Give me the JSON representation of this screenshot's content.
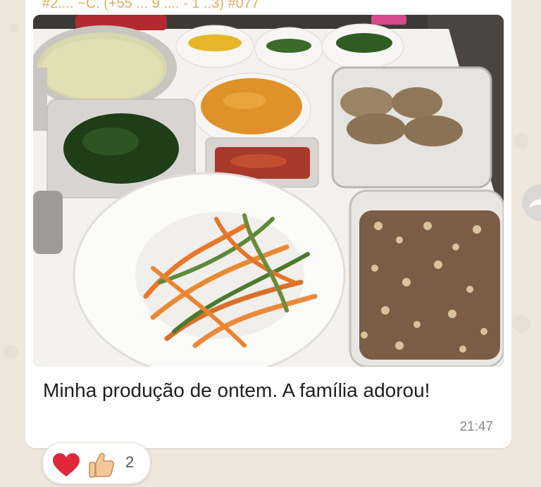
{
  "message": {
    "sender_line": "#2.... ~C. (+55 ... 9 .... - 1 ..3) #077",
    "image_alt": "Mesa com vários pratos de comida preparada",
    "caption": "Minha produção de ontem. A família adorou!",
    "time": "21:47"
  },
  "reactions": {
    "heart": "❤",
    "thumbs_up": "👍",
    "count": "2"
  },
  "colors": {
    "wallpaper": "#efe7dc",
    "bubble": "#ffffff",
    "time": "#8a8a8a",
    "heart": "#e0283a"
  },
  "icons": {
    "forward": "forward-icon",
    "heart": "heart-icon",
    "thumb": "thumbs-up-icon"
  }
}
